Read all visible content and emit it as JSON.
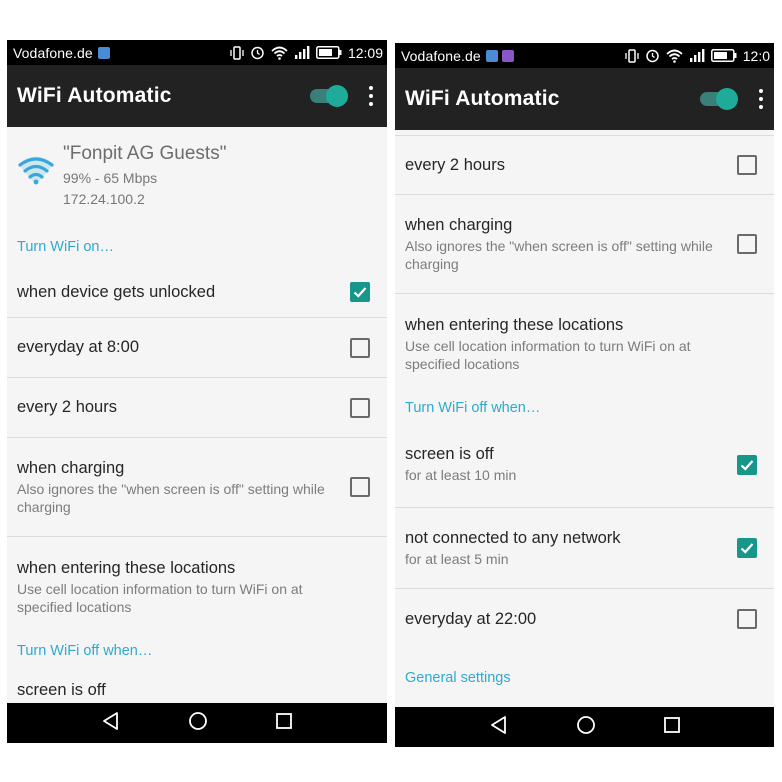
{
  "status_bar": {
    "carrier": "Vodafone.de",
    "time": "12:09",
    "time_right": "12:0"
  },
  "app_bar": {
    "title": "WiFi Automatic",
    "wifi_switch_on": true
  },
  "connection": {
    "ssid": "\"Fonpit AG Guests\"",
    "signal_speed": "99% - 65 Mbps",
    "ip": "172.24.100.2"
  },
  "sections": {
    "turn_on": "Turn WiFi on…",
    "turn_off": "Turn WiFi off when…",
    "general": "General settings"
  },
  "turn_on_items": [
    {
      "title": "when device gets unlocked",
      "subtitle": "",
      "checked": true
    },
    {
      "title": "everyday at 8:00",
      "subtitle": "",
      "checked": false
    },
    {
      "title": "every 2 hours",
      "subtitle": "",
      "checked": false
    },
    {
      "title": "when charging",
      "subtitle": "Also ignores the \"when screen is off\" setting while charging",
      "checked": false
    },
    {
      "title": "when entering these locations",
      "subtitle": "Use cell location information to turn WiFi on at specified locations",
      "checked": null
    }
  ],
  "turn_off_items": [
    {
      "title": "screen is off",
      "subtitle": "for at least 10 min",
      "checked": true
    },
    {
      "title": "not connected to any network",
      "subtitle": "for at least 5 min",
      "checked": true
    },
    {
      "title": "everyday at 22:00",
      "subtitle": "",
      "checked": false
    }
  ],
  "colors": {
    "accent": "#2eaad0",
    "checkbox_checked": "#17978a",
    "appbar": "#222222",
    "switch_thumb": "#1eab9a"
  }
}
